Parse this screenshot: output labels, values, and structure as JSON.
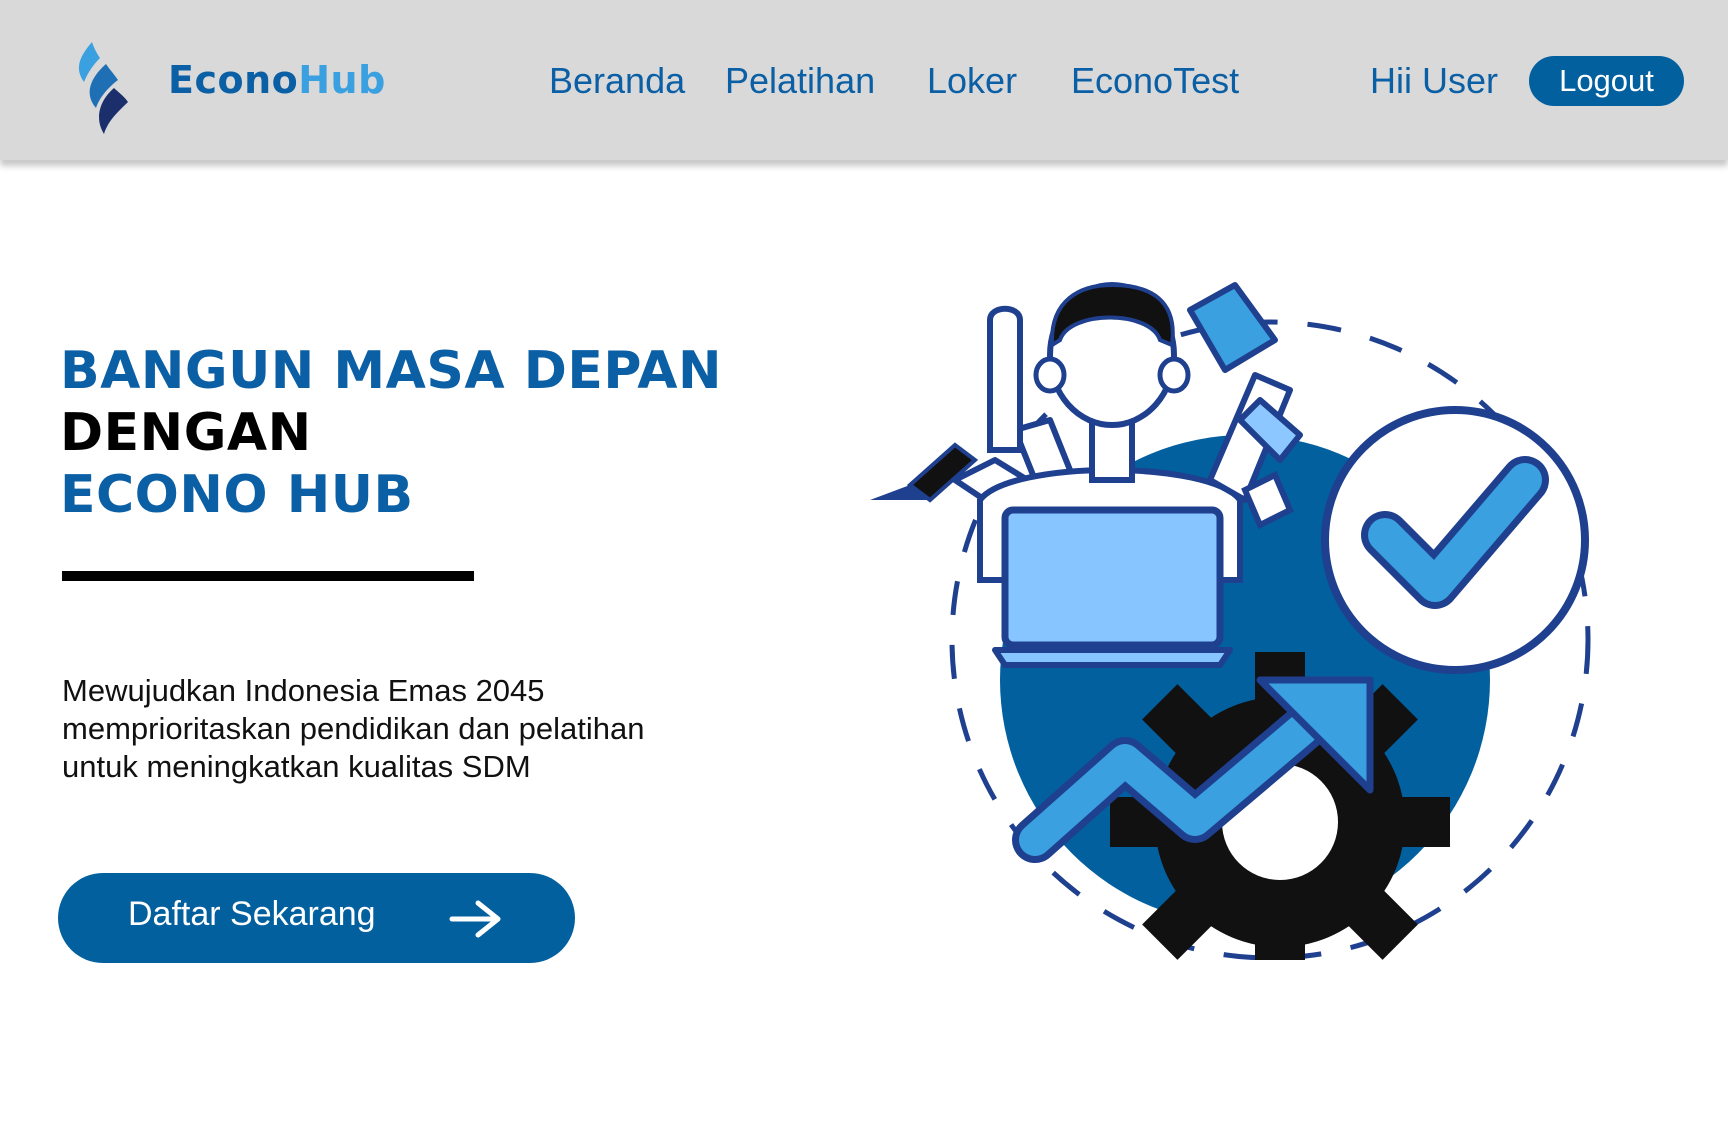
{
  "brand": {
    "part1": "Econo",
    "part2": "Hub"
  },
  "nav": {
    "items": [
      {
        "label": "Beranda"
      },
      {
        "label": "Pelatihan"
      },
      {
        "label": "Loker"
      },
      {
        "label": "EconoTest"
      }
    ],
    "greeting": "Hii User",
    "logout_label": "Logout"
  },
  "hero": {
    "title_line1": "BANGUN MASA DEPAN",
    "title_line2": "DENGAN",
    "title_line3": "ECONO HUB",
    "desc_line1": "Mewujudkan Indonesia Emas 2045",
    "desc_line2": "memprioritaskan pendidikan dan pelatihan",
    "desc_line3": "untuk meningkatkan kualitas SDM",
    "cta_label": "Daftar Sekarang"
  },
  "colors": {
    "primary": "#03609f",
    "accent": "#3aa0e0",
    "navbar_bg": "#d9d9d9"
  },
  "icons": [
    "flame-logo-icon",
    "arrow-right-icon"
  ]
}
